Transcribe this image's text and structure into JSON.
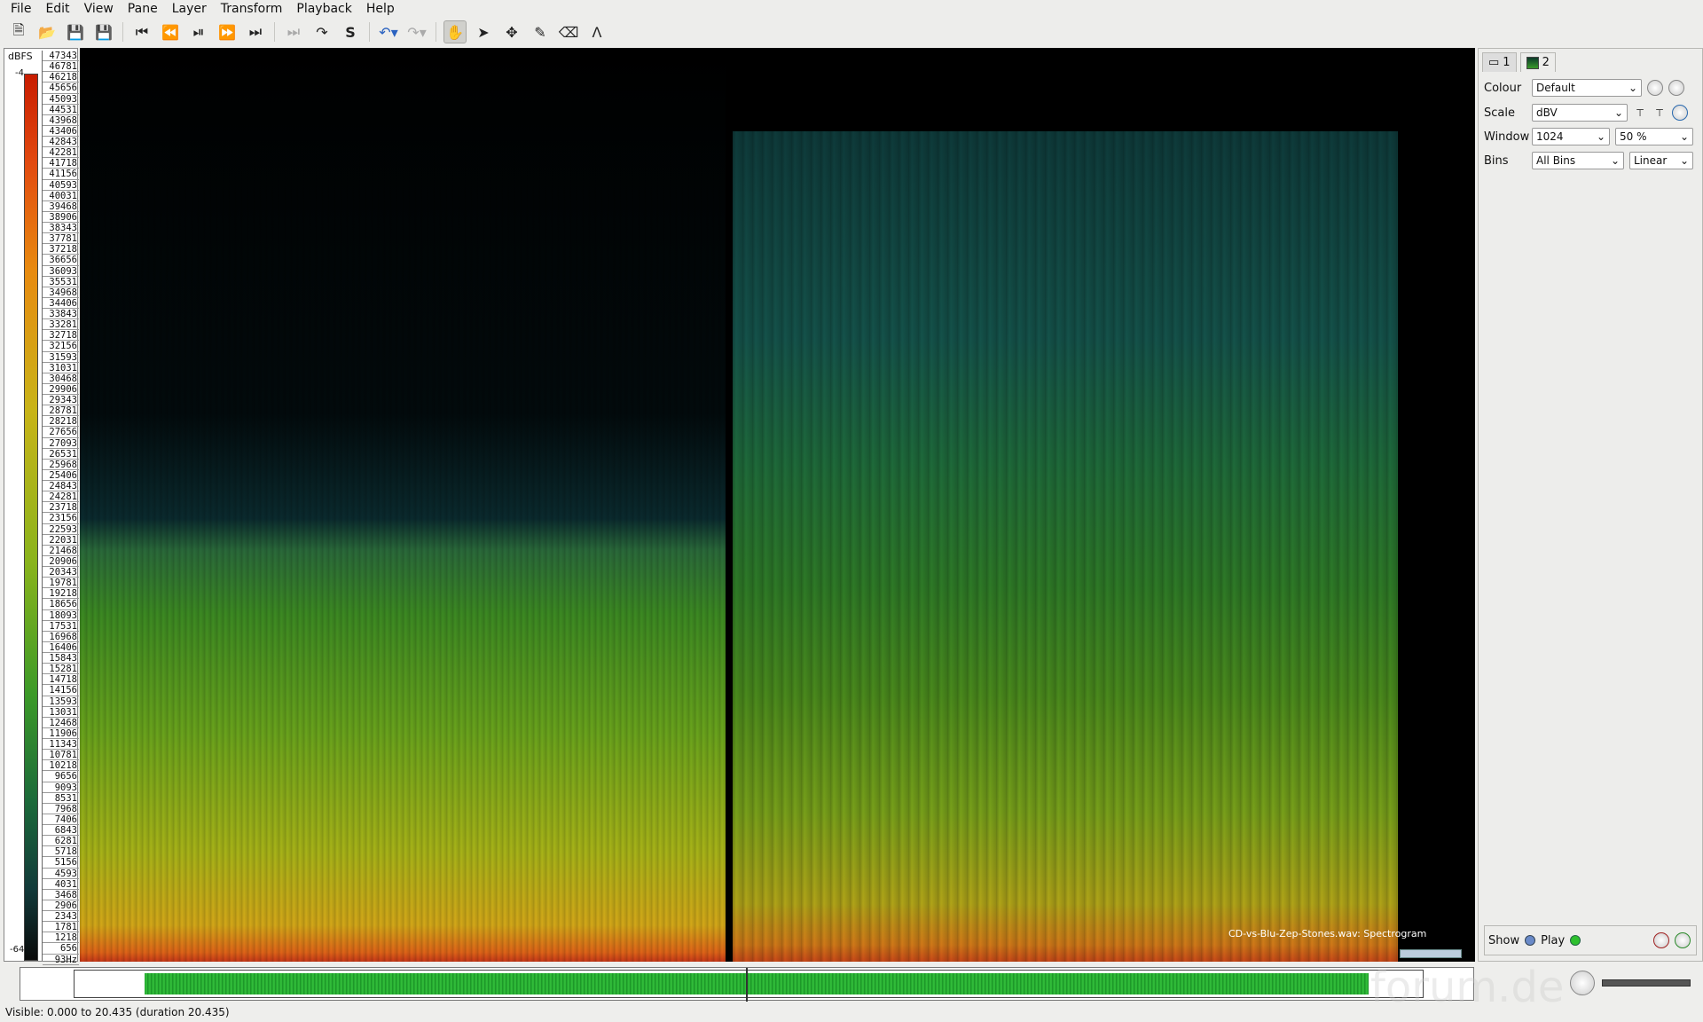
{
  "menu": [
    "File",
    "Edit",
    "View",
    "Pane",
    "Layer",
    "Transform",
    "Playback",
    "Help"
  ],
  "toolbar": {
    "icons": [
      "new-file-icon",
      "open-file-icon",
      "save-icon",
      "save-as-icon",
      "rewind-start-icon",
      "rewind-icon",
      "play-pause-icon",
      "fast-forward-icon",
      "ffwd-end-icon",
      "record-icon",
      "play-selection-icon",
      "loop-icon",
      "undo-icon",
      "redo-icon",
      "navigate-tool-icon",
      "select-tool-icon",
      "move-tool-icon",
      "draw-tool-icon",
      "erase-tool-icon",
      "measure-tool-icon"
    ]
  },
  "scale": {
    "title": "dBFS",
    "top": "-4",
    "bottom": "-64",
    "freqs": [
      "47343",
      "46781",
      "46218",
      "45656",
      "45093",
      "44531",
      "43968",
      "43406",
      "42843",
      "42281",
      "41718",
      "41156",
      "40593",
      "40031",
      "39468",
      "38906",
      "38343",
      "37781",
      "37218",
      "36656",
      "36093",
      "35531",
      "34968",
      "34406",
      "33843",
      "33281",
      "32718",
      "32156",
      "31593",
      "31031",
      "30468",
      "29906",
      "29343",
      "28781",
      "28218",
      "27656",
      "27093",
      "26531",
      "25968",
      "25406",
      "24843",
      "24281",
      "23718",
      "23156",
      "22593",
      "22031",
      "21468",
      "20906",
      "20343",
      "19781",
      "19218",
      "18656",
      "18093",
      "17531",
      "16968",
      "16406",
      "15843",
      "15281",
      "14718",
      "14156",
      "13593",
      "13031",
      "12468",
      "11906",
      "11343",
      "10781",
      "10218",
      "9656",
      "9093",
      "8531",
      "7968",
      "7406",
      "6843",
      "6281",
      "5718",
      "5156",
      "4593",
      "4031",
      "3468",
      "2906",
      "2343",
      "1781",
      "1218",
      "656",
      "93Hz"
    ]
  },
  "spectrogram": {
    "label": "CD-vs-Blu-Zep-Stones.wav: Spectrogram"
  },
  "panel": {
    "tab1": "1",
    "tab2": "2",
    "colour_label": "Colour",
    "colour_value": "Default",
    "scale_label": "Scale",
    "scale_value": "dBV",
    "window_label": "Window",
    "window_value": "1024",
    "overlap_value": "50 %",
    "bins_label": "Bins",
    "bins_value": "All Bins",
    "binscale_value": "Linear",
    "show_label": "Show",
    "play_label": "Play"
  },
  "status": "Visible: 0.000 to 20.435 (duration 20.435)",
  "watermark": "forum.de"
}
